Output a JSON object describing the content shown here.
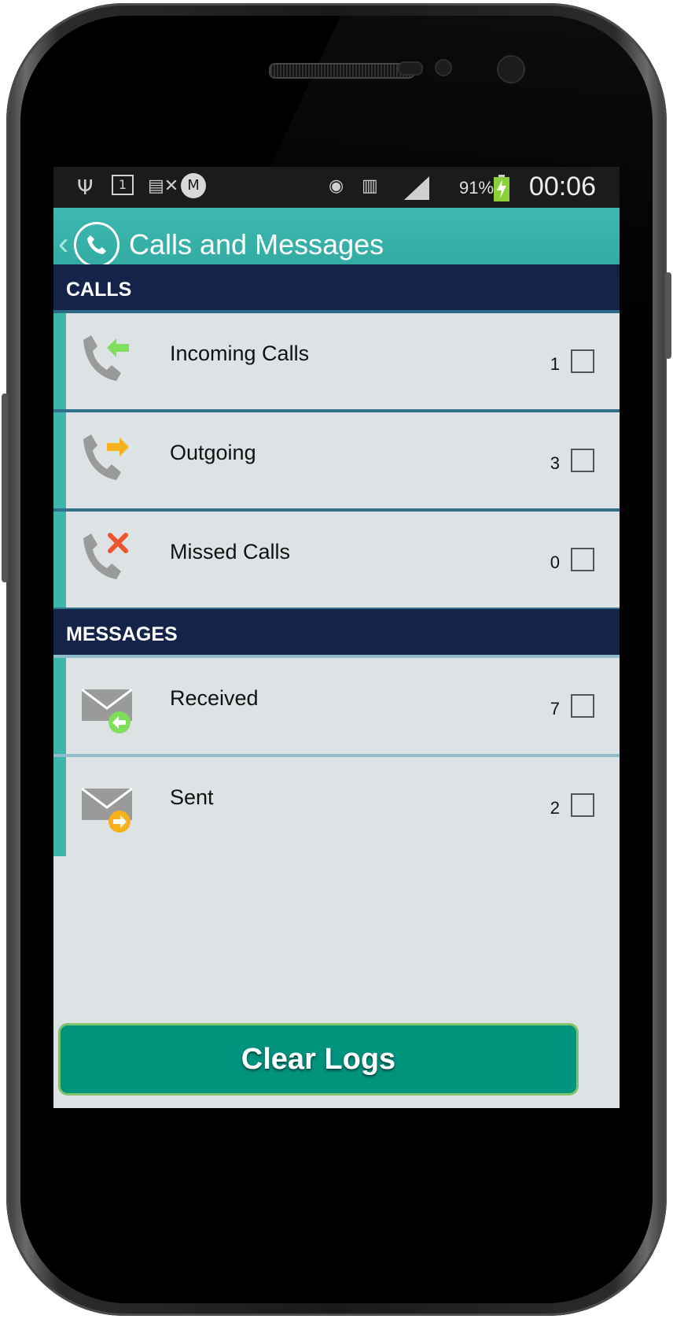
{
  "status_bar": {
    "time": "00:06",
    "battery_percent": "91%",
    "icons": [
      "usb-icon",
      "calendar-icon",
      "sim-missing-icon",
      "motorola-icon",
      "eye-icon",
      "vibrate-off-icon",
      "signal-icon",
      "battery-charging-icon"
    ],
    "calendar_day": "1"
  },
  "app_bar": {
    "title": "Calls and Messages",
    "back_glyph": "‹",
    "logo_icon": "phone-icon"
  },
  "sections": {
    "calls": {
      "header": "CALLS",
      "items": [
        {
          "label": "Incoming Calls",
          "count": "1",
          "icon": "incoming-call-icon",
          "arrow_color": "#7ee05a"
        },
        {
          "label": "Outgoing",
          "count": "3",
          "icon": "outgoing-call-icon",
          "arrow_color": "#f5b11b"
        },
        {
          "label": "Missed Calls",
          "count": "0",
          "icon": "missed-call-icon",
          "arrow_color": "#f0542a"
        }
      ]
    },
    "messages": {
      "header": "MESSAGES",
      "items": [
        {
          "label": "Received",
          "count": "7",
          "icon": "received-message-icon",
          "badge_color": "#7ee05a"
        },
        {
          "label": "Sent",
          "count": "2",
          "icon": "sent-message-icon",
          "badge_color": "#f5b11b"
        }
      ]
    }
  },
  "actions": {
    "clear_logs": "Clear Logs"
  },
  "colors": {
    "app_bar": "#3db8b0",
    "section_header": "#13234a",
    "row_accent": "#3eb5ab",
    "button": "#00937e"
  }
}
